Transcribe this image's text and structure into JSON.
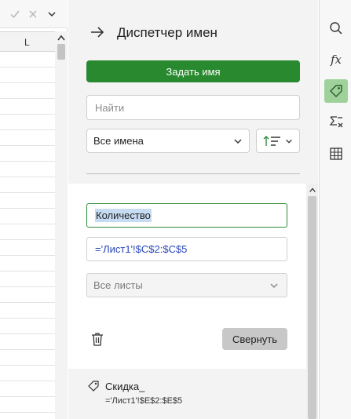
{
  "sheet": {
    "column_label": "L",
    "rows": 24,
    "icons": [
      "confirm-icon",
      "cancel-icon",
      "chevron-down-icon"
    ]
  },
  "panel": {
    "title": "Диспетчер имен",
    "define_name_label": "Задать имя",
    "search_placeholder": "Найти",
    "filter_value": "Все имена",
    "edit": {
      "name_value": "Количество",
      "reference_value": "='Лист1'!$C$2:$C$5",
      "scope_value": "Все листы",
      "collapse_label": "Свернуть"
    },
    "items": [
      {
        "name": "Скидка_",
        "reference": "='Лист1'!$E$2:$E$5"
      }
    ]
  },
  "toolbar": {
    "tools": [
      "search-icon",
      "function-icon",
      "tag-icon",
      "formula-check-icon",
      "table-icon"
    ],
    "active": "tag-icon",
    "accent_color": "#28892e",
    "active_bg": "#9fd29a"
  }
}
